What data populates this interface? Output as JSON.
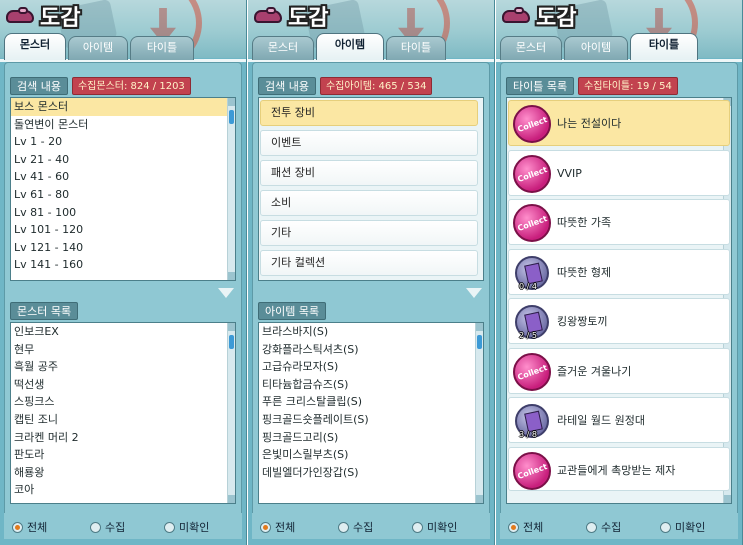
{
  "panels": [
    {
      "title": "도감",
      "tabs": [
        "몬스터",
        "아이템",
        "타이틀"
      ],
      "active_tab": 0,
      "search": {
        "label": "검색 내용",
        "count": "수집몬스터:  824 / 1203"
      },
      "search_items": [
        "보스 몬스터",
        "돌연변이 몬스터",
        "Lv 1 - 20",
        "Lv 21 - 40",
        "Lv 41 - 60",
        "Lv 61 - 80",
        "Lv 81 - 100",
        "Lv 101 - 120",
        "Lv 121 - 140",
        "Lv 141 - 160"
      ],
      "list": {
        "label": "몬스터 목록"
      },
      "list_items": [
        "인보크EX",
        "현무",
        "흑월 공주",
        "떡선생",
        "스핑크스",
        "캡틴 조니",
        "크라켄 머리 2",
        "판도라",
        "해룡왕",
        "코아"
      ],
      "filters": [
        "전체",
        "수집",
        "미확인"
      ]
    },
    {
      "title": "도감",
      "tabs": [
        "몬스터",
        "아이템",
        "타이틀"
      ],
      "active_tab": 1,
      "search": {
        "label": "검색 내용",
        "count": "수집아이템:  465 / 534"
      },
      "categories": [
        "전투 장비",
        "이벤트",
        "패션 장비",
        "소비",
        "기타",
        "기타 컬렉션"
      ],
      "list": {
        "label": "아이템 목록"
      },
      "list_items": [
        "브라스바지(S)",
        "강화플라스틱셔츠(S)",
        "고급슈라모자(S)",
        "티타늄합금슈즈(S)",
        "푸른 크리스탈클립(S)",
        "핑크골드숏플레이트(S)",
        "핑크골드고리(S)",
        "은빛미스릴부츠(S)",
        "데빌엘더가인장갑(S)"
      ],
      "filters": [
        "전체",
        "수집",
        "미확인"
      ]
    },
    {
      "title": "도감",
      "tabs": [
        "몬스터",
        "아이템",
        "타이틀"
      ],
      "active_tab": 2,
      "search": {
        "label": "타이틀 목록",
        "count": "수집타이틀:  19  /  54"
      },
      "titles": [
        {
          "name": "나는 전설이다",
          "icon": "collect-badge-icon",
          "badge_text": "Collect",
          "progress": ""
        },
        {
          "name": "VVIP",
          "icon": "collect-badge-icon",
          "badge_text": "Collect",
          "progress": ""
        },
        {
          "name": "따뜻한 가족",
          "icon": "collect-badge-icon",
          "badge_text": "Collect",
          "progress": ""
        },
        {
          "name": "따뜻한 형제",
          "icon": "book-badge-icon",
          "badge_text": "",
          "progress": "0 / 4"
        },
        {
          "name": "킹왕짱토끼",
          "icon": "book-badge-icon",
          "badge_text": "",
          "progress": "2 / 5"
        },
        {
          "name": "즐거운 겨울나기",
          "icon": "collect-badge-icon",
          "badge_text": "Collect",
          "progress": ""
        },
        {
          "name": "라테일 월드 원정대",
          "icon": "book-badge-icon",
          "badge_text": "",
          "progress": "3 / 8"
        },
        {
          "name": "교관들에게 촉망받는 제자",
          "icon": "collect-badge-icon",
          "badge_text": "Collect",
          "progress": ""
        }
      ],
      "filters": [
        "전체",
        "수집",
        "미확인"
      ]
    }
  ]
}
